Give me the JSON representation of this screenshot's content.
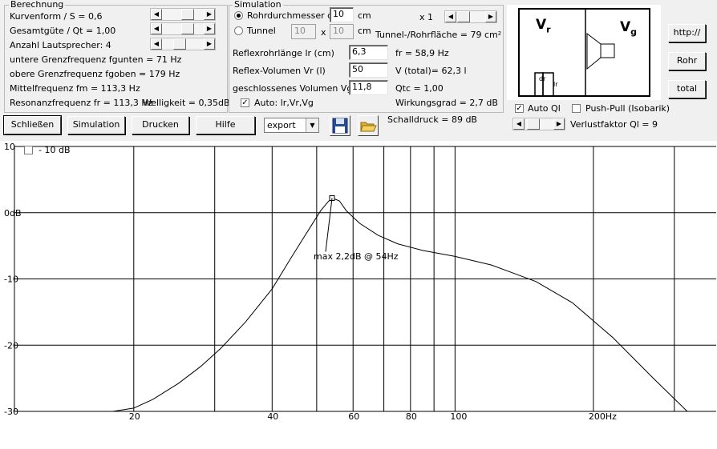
{
  "calc_group": {
    "legend": "Berechnung",
    "kurvenform": "Kurvenform / S = 0,6",
    "guete": "Gesamtgüte / Qt = 1,00",
    "lautsprecher": "Anzahl Lautsprecher: 4",
    "fgunten": "untere Grenzfrequenz fgunten = 71 Hz",
    "fgoben": "obere Grenzfrequenz fgoben = 179 Hz",
    "fm": "Mittelfrequenz fm = 113,3 Hz",
    "fr": "Resonanzfrequenz fr = 113,3 Hz",
    "welligkeit": "Welligkeit = 0,35dB"
  },
  "sim_group": {
    "legend": "Simulation",
    "radio_rohr": "Rohrdurchmesser dr",
    "radio_tunnel": "Tunnel",
    "dr_value": "10",
    "dr_unit": "cm",
    "tunnel_a": "10",
    "tunnel_x": "x",
    "tunnel_b": "10",
    "tunnel_unit": "cm",
    "multiplier": "x 1",
    "tunnel_area": "Tunnel-/Rohrfläche = 79 cm²",
    "lr_label": "Reflexrohrlänge lr (cm)",
    "lr_value": "6,3",
    "fr_result": "fr = 58,9 Hz",
    "vr_label": "Reflex-Volumen Vr (l)",
    "vr_value": "50",
    "vtotal": "V (total)= 62,3 l",
    "vg_label": "geschlossenes Volumen Vg (l)",
    "vg_value": "11,8",
    "qtc": "Qtc = 1,00",
    "auto_label": "Auto: lr,Vr,Vg",
    "wirkungsgrad": "Wirkungsgrad = 2,7 dB"
  },
  "diagram": {
    "vr": "V",
    "vr_sub": "r",
    "vg": "V",
    "vg_sub": "g",
    "dr": "dr",
    "lr": "lr"
  },
  "right_buttons": {
    "http": "http://",
    "rohr": "Rohr",
    "total": "total"
  },
  "options": {
    "auto_ql": "Auto Ql",
    "push_pull": "Push-Pull (Isobarik)",
    "verlustfaktor": "Verlustfaktor Ql = 9"
  },
  "toolbar": {
    "schliessen": "Schließen",
    "simulation": "Simulation",
    "drucken": "Drucken",
    "hilfe": "Hilfe",
    "export": "export",
    "schalldruck": "Schalldruck = 89 dB"
  },
  "plot": {
    "minus10_label": "- 10 dB",
    "annotation": "max 2,2dB @ 54Hz"
  },
  "chart_data": {
    "type": "line",
    "xscale": "log",
    "xlim": [
      11,
      370
    ],
    "ylim": [
      -30,
      10
    ],
    "grid": true,
    "ytick_labels": [
      "10",
      "0dB",
      "-10",
      "-20",
      "-30"
    ],
    "ytick_values": [
      10,
      0,
      -10,
      -20,
      -30
    ],
    "xtick_labels": [
      "20",
      "40",
      "60",
      "80",
      "100",
      "200Hz"
    ],
    "xtick_values": [
      20,
      40,
      60,
      80,
      100,
      200
    ],
    "x": [
      18,
      20,
      22,
      25,
      28,
      31,
      35,
      40,
      44,
      48,
      51,
      53,
      54,
      56,
      58,
      62,
      68,
      75,
      85,
      100,
      120,
      150,
      180,
      220,
      270,
      320
    ],
    "y": [
      -30,
      -29.5,
      -28.2,
      -25.8,
      -23.2,
      -20.4,
      -16.5,
      -11.5,
      -6.8,
      -2.6,
      0.3,
      1.7,
      2.2,
      1.8,
      0.3,
      -1.6,
      -3.4,
      -4.7,
      -5.7,
      -6.6,
      -7.9,
      -10.4,
      -13.6,
      -18.8,
      -25.0,
      -30
    ]
  }
}
